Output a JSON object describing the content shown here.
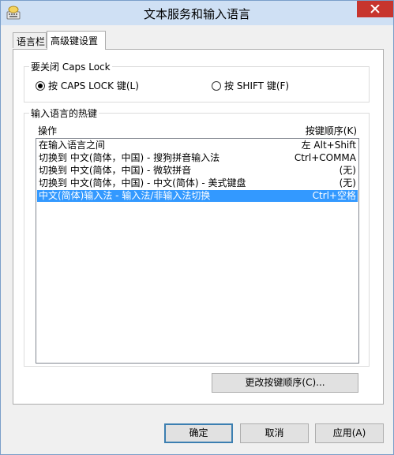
{
  "window": {
    "title": "文本服务和输入语言"
  },
  "tabs": [
    {
      "label": "语言栏"
    },
    {
      "label": "高级键设置"
    }
  ],
  "caps_group": {
    "caption": "要关闭 Caps Lock",
    "option_caps": "按 CAPS LOCK 键(L)",
    "option_shift": "按 SHIFT 键(F)",
    "selected": "option_caps"
  },
  "hotkeys_group": {
    "caption": "输入语言的热键",
    "columns": {
      "action": "操作",
      "key_sequence": "按键顺序(K)"
    },
    "rows": [
      {
        "action": "在输入语言之间",
        "keys": "左 Alt+Shift",
        "selected": false
      },
      {
        "action": "切换到 中文(简体，中国) - 搜狗拼音输入法",
        "keys": "Ctrl+COMMA",
        "selected": false
      },
      {
        "action": "切换到 中文(简体，中国) - 微软拼音",
        "keys": "(无)",
        "selected": false
      },
      {
        "action": "切换到 中文(简体，中国) - 中文(简体) - 美式键盘",
        "keys": "(无)",
        "selected": false
      },
      {
        "action": "中文(简体)输入法 - 输入法/非输入法切换",
        "keys": "Ctrl+空格",
        "selected": true
      }
    ],
    "change_button": "更改按键顺序(C)..."
  },
  "footer": {
    "ok": "确定",
    "cancel": "取消",
    "apply": "应用(A)"
  },
  "colors": {
    "selection": "#3399ff",
    "close_button": "#c7352e",
    "titlebar": "#cfe0f4"
  },
  "icons": {
    "app": "keyboard-language-icon",
    "close": "close-icon"
  }
}
